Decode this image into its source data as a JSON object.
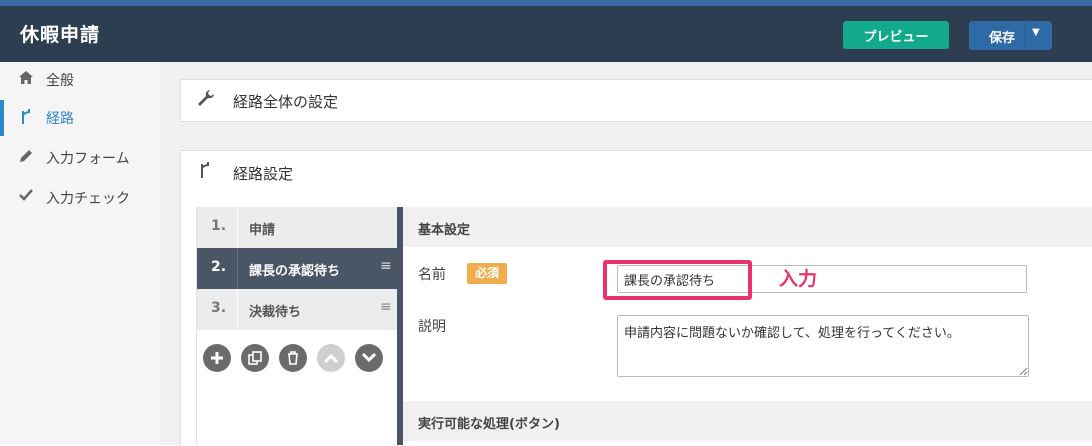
{
  "header": {
    "title": "休暇申請",
    "preview_label": "プレビュー",
    "save_label": "保存",
    "colors": {
      "bar": "#2d3e50",
      "preview": "#13a98c",
      "save": "#2e6aa6"
    }
  },
  "sidebar": {
    "items": [
      {
        "label": "全般",
        "icon": "home-icon"
      },
      {
        "label": "経路",
        "icon": "route-icon",
        "active": true
      },
      {
        "label": "入力フォーム",
        "icon": "pencil-icon"
      },
      {
        "label": "入力チェック",
        "icon": "check-icon"
      }
    ]
  },
  "route_global": {
    "title": "経路全体の設定",
    "icon": "wrench-icon"
  },
  "route_settings": {
    "title": "経路設定",
    "icon": "route-icon"
  },
  "steps": [
    {
      "num": "1.",
      "name": "申請"
    },
    {
      "num": "2.",
      "name": "課長の承認待ち",
      "active": true
    },
    {
      "num": "3.",
      "name": "決裁待ち"
    }
  ],
  "step_actions": [
    "add-icon",
    "copy-icon",
    "trash-icon",
    "chevron-up-icon",
    "chevron-down-icon"
  ],
  "detail": {
    "basic_title": "基本設定",
    "name_label": "名前",
    "required_badge": "必須",
    "name_value": "課長の承認待ち",
    "desc_label": "説明",
    "desc_value": "申請内容に問題ないか確認して、処理を行ってください。",
    "actions_title": "実行可能な処理(ボタン)"
  },
  "annotation": {
    "text": "入力",
    "color": "#e8336c"
  }
}
